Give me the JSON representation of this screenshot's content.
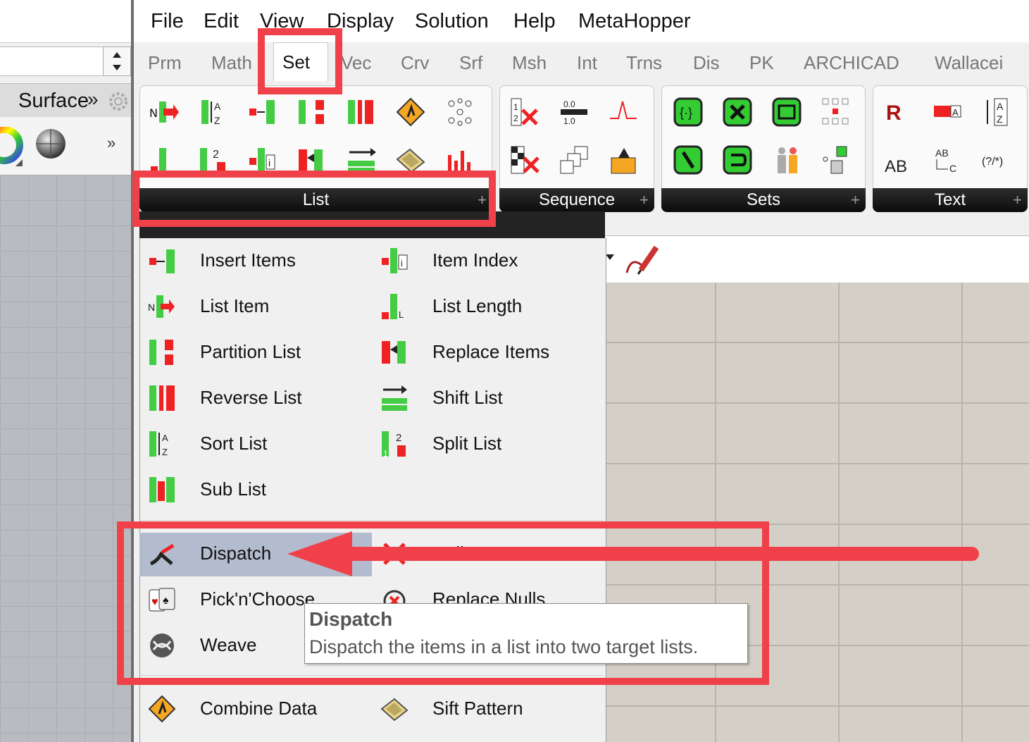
{
  "left_panel": {
    "tab_label": "Surface",
    "tab_overflow": "»",
    "icon_overflow": "»"
  },
  "menubar": [
    "File",
    "Edit",
    "View",
    "Display",
    "Solution",
    "Help",
    "MetaHopper"
  ],
  "tabs": [
    "Prm",
    "Math",
    "Set",
    "Vec",
    "Crv",
    "Srf",
    "Msh",
    "Int",
    "Trns",
    "Dis",
    "PK",
    "ARCHICAD",
    "Wallacei"
  ],
  "active_tab": "Set",
  "ribbon_groups": [
    {
      "label": "List",
      "plus": "+"
    },
    {
      "label": "Sequence",
      "plus": "+"
    },
    {
      "label": "Sets",
      "plus": "+"
    },
    {
      "label": "Text",
      "plus": "+"
    }
  ],
  "dropdown": {
    "items_left": [
      "Insert Items",
      "List Item",
      "Partition List",
      "Reverse List",
      "Sort List",
      "Sub List"
    ],
    "items_right": [
      "Item Index",
      "List Length",
      "Replace Items",
      "Shift List",
      "Split List"
    ],
    "group2_left": [
      "Dispatch",
      "Pick'n'Choose",
      "Weave"
    ],
    "group2_right": [
      "Null Item",
      "Replace Nulls"
    ],
    "group3_left": [
      "Combine Data"
    ],
    "group3_right": [
      "Sift Pattern"
    ]
  },
  "tooltip": {
    "title": "Dispatch",
    "description": "Dispatch the items in a list into two target lists."
  },
  "colors": {
    "annotation_red": "#f0414a",
    "hover_highlight": "#b3bccf",
    "group_bar": "#111111"
  }
}
